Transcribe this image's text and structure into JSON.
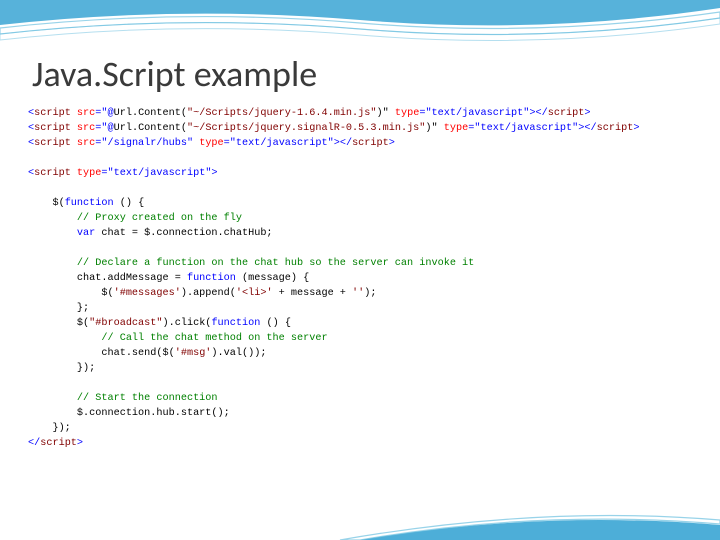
{
  "title": "Java.Script example",
  "code": {
    "line1_a": "<",
    "line1_b": "script ",
    "line1_c": "src",
    "line1_d": "=\"@",
    "line1_e": "Url.Content(",
    "line1_f": "\"~/Scripts/jquery-1.6.4.min.js\"",
    "line1_g": ")\"",
    "line1_h": " type",
    "line1_i": "=\"text/javascript\"></",
    "line1_j": "script",
    "line1_k": ">",
    "line2_a": "<",
    "line2_b": "script ",
    "line2_c": "src",
    "line2_d": "=\"@",
    "line2_e": "Url.Content(",
    "line2_f": "\"~/Scripts/jquery.signalR-0.5.3.min.js\"",
    "line2_g": ")\"",
    "line2_h": " type",
    "line2_i": "=\"text/javascript\"></",
    "line2_j": "script",
    "line2_k": ">",
    "line3_a": "<",
    "line3_b": "script ",
    "line3_c": "src",
    "line3_d": "=\"/signalr/hubs\"",
    "line3_e": " type",
    "line3_f": "=\"text/javascript\"></",
    "line3_g": "script",
    "line3_h": ">",
    "line5_a": "<",
    "line5_b": "script ",
    "line5_c": "type",
    "line5_d": "=\"text/javascript\">",
    "line7": "    $(",
    "line7_b": "function",
    "line7_c": " () {",
    "line8": "        // Proxy created on the fly",
    "line9_a": "        var",
    "line9_b": " chat = $.connection.chatHub;",
    "line11": "        // Declare a function on the chat hub so the server can invoke it",
    "line12_a": "        chat.addMessage = ",
    "line12_b": "function",
    "line12_c": " (message) {",
    "line13_a": "            $(",
    "line13_b": "'#messages'",
    "line13_c": ").append(",
    "line13_d": "'<li>'",
    "line13_e": " + message + ",
    "line13_f": "''",
    "line13_g": ");",
    "line14": "        };",
    "line15_a": "        $(",
    "line15_b": "\"#broadcast\"",
    "line15_c": ").click(",
    "line15_d": "function",
    "line15_e": " () {",
    "line16": "            // Call the chat method on the server",
    "line17_a": "            chat.send($(",
    "line17_b": "'#msg'",
    "line17_c": ").val());",
    "line18": "        });",
    "line20": "        // Start the connection",
    "line21": "        $.connection.hub.start();",
    "line22": "    });",
    "line23_a": "</",
    "line23_b": "script",
    "line23_c": ">"
  }
}
